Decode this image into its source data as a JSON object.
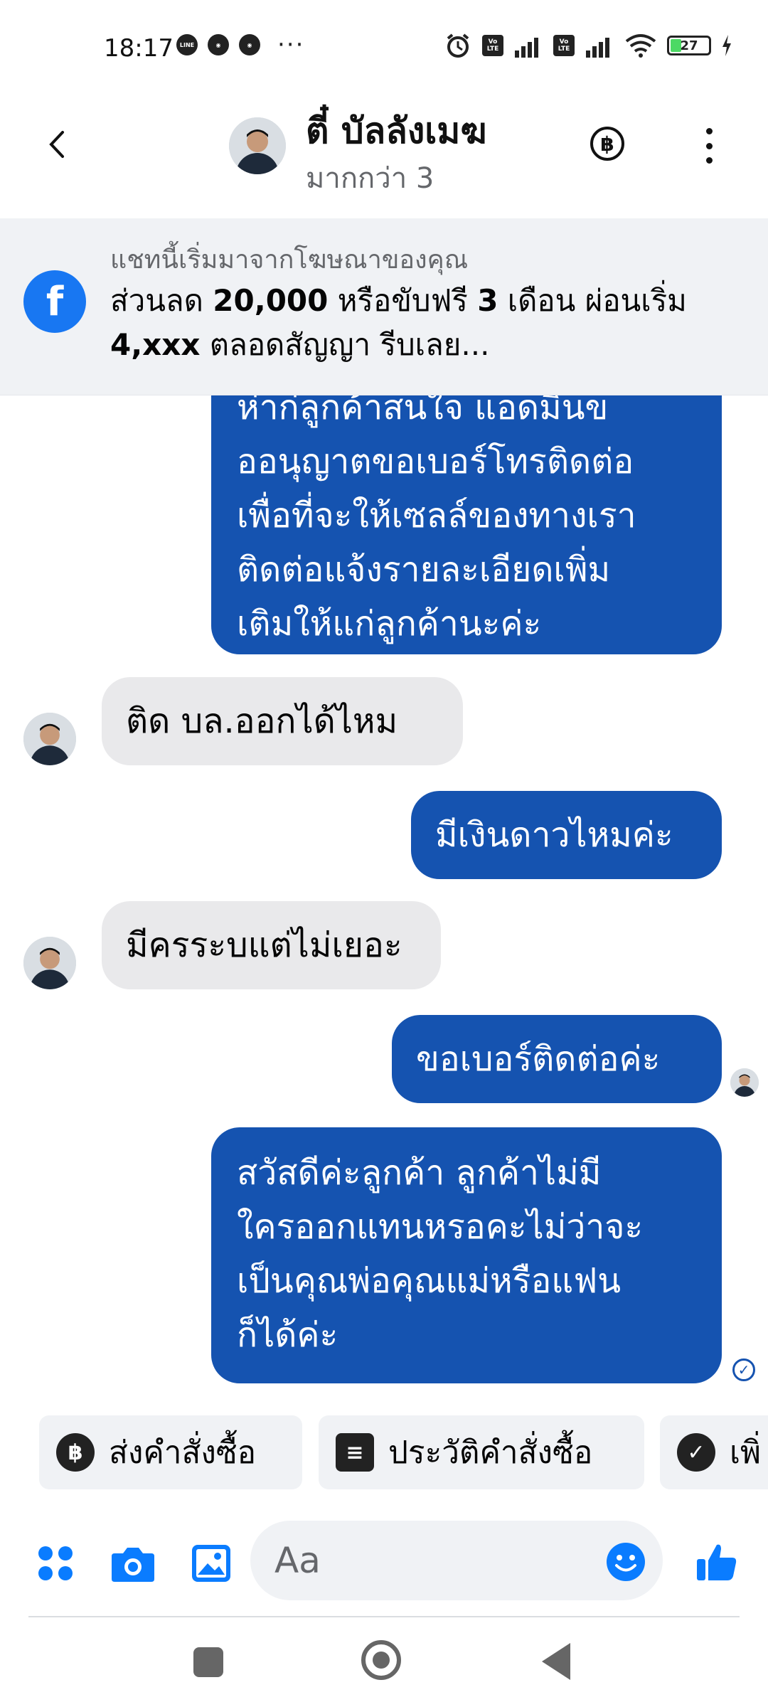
{
  "status_bar": {
    "time": "18:17",
    "notification_icons": [
      "line-icon",
      "chrome-icon",
      "chrome-icon"
    ],
    "overflow": "···",
    "volte_label_top": "Vo",
    "volte_label_bottom": "LTE",
    "battery_level": "27"
  },
  "header": {
    "name": "ตี๋ บัลลังเมฆ",
    "subtitle": "มากกว่า 3",
    "baht_symbol": "฿"
  },
  "ad_banner": {
    "caption": "แชทนี้เริ่มมาจากโฆษณาของคุณ",
    "text_part1": "ส่วนลด ",
    "text_bold1": "20,000",
    "text_part2": " หรือขับฟรี ",
    "text_bold2": "3",
    "text_part3": " เดือน ผ่อนเริ่ม ",
    "text_bold3": "4,xxx",
    "text_part4": " ตลอดสัญญา รีบเลย...",
    "icon_letter": "f"
  },
  "messages": [
    {
      "direction": "out",
      "lines": [
        "ห่าก่ลูกค้าสนใจ แอดมินข",
        "ออนุญาตขอเบอร์โทรติดต่อ",
        "เพื่อที่จะให้เซลล์ของทางเรา",
        "ติดต่อแจ้งรายละเอียดเพิ่ม",
        "เติมให้แก่ลูกค้านะค่ะ"
      ]
    },
    {
      "direction": "in",
      "text": "ติด บล.ออกได้ไหม"
    },
    {
      "direction": "out",
      "text": "มีเงินดาวไหมค่ะ"
    },
    {
      "direction": "in",
      "text": "มีครระบแต่ไม่เยอะ"
    },
    {
      "direction": "out",
      "text": "ขอเบอร์ติดต่อค่ะ"
    },
    {
      "direction": "out",
      "lines": [
        "สวัสดีค่ะลูกค้า ลูกค้าไม่มี",
        "ใครออกแทนหรอคะไม่ว่าจะ",
        "เป็นคุณพ่อคุณแม่หรือแฟน",
        "ก็ได้ค่ะ"
      ]
    }
  ],
  "quick_actions": [
    {
      "label": "ส่งคำสั่งซื้อ",
      "icon": "baht-icon",
      "symbol": "฿"
    },
    {
      "label": "ประวัติคำสั่งซื้อ",
      "icon": "receipt-icon",
      "symbol": "≡"
    },
    {
      "label": "เพิ่",
      "icon": "check-icon",
      "symbol": "✓"
    }
  ],
  "composer": {
    "placeholder": "Aa"
  },
  "colors": {
    "accent": "#1553b0",
    "brand_blue": "#0a7cff",
    "facebook": "#1877f2"
  }
}
